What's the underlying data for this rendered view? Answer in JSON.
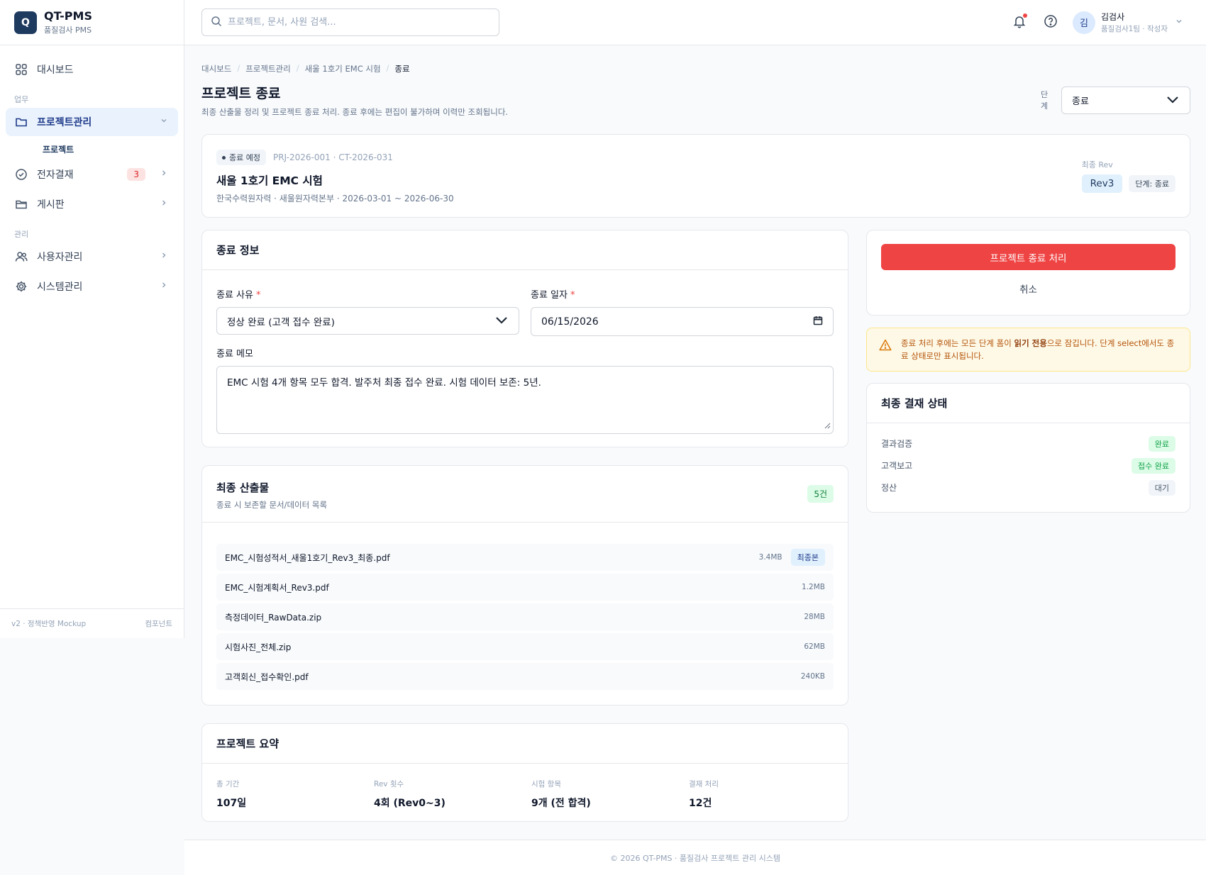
{
  "brand": {
    "logo": "Q",
    "title": "QT-PMS",
    "subtitle": "품질검사 PMS"
  },
  "sidebar": {
    "items": [
      {
        "label": "대시보드",
        "icon": "dashboard-icon"
      },
      {
        "section": "업무"
      },
      {
        "label": "프로젝트관리",
        "icon": "folder-icon",
        "active": true
      },
      {
        "sub": "프로젝트"
      },
      {
        "label": "전자결재",
        "icon": "check-circle-icon",
        "badge": "3"
      },
      {
        "label": "게시판",
        "icon": "folder-open-icon"
      },
      {
        "section": "관리"
      },
      {
        "label": "사용자관리",
        "icon": "users-icon"
      },
      {
        "label": "시스템관리",
        "icon": "gear-icon"
      }
    ],
    "footer_left": "v2 · 정책반영 Mockup",
    "footer_right": "컴포넌트"
  },
  "topbar": {
    "search_placeholder": "프로젝트, 문서, 사원 검색...",
    "user": {
      "initial": "김",
      "name": "김검사",
      "role": "품질검사1팀 · 작성자"
    }
  },
  "breadcrumb": [
    "대시보드",
    "프로젝트관리",
    "새울 1호기 EMC 시험",
    "종료"
  ],
  "page": {
    "title": "프로젝트 종료",
    "desc": "최종 산출물 정리 및 프로젝트 종료 처리. 종료 후에는 편집이 불가하며 이력만 조회됩니다.",
    "stage_label": "단계",
    "stage_value": "종료"
  },
  "project": {
    "status": "종료 예정",
    "codes": "PRJ-2026-001 · CT-2026-031",
    "name": "새울 1호기 EMC 시험",
    "meta": "한국수력원자력 · 새울원자력본부 · 2026-03-01 ~ 2026-06-30",
    "rev_label": "최종 Rev",
    "rev": "Rev3",
    "stage_tag": "단계: 종료"
  },
  "close_info": {
    "title": "종료 정보",
    "reason_label": "종료 사유",
    "reason_value": "정상 완료 (고객 접수 완료)",
    "date_label": "종료 일자",
    "date_value": "06/15/2026",
    "memo_label": "종료 메모",
    "memo_value": "EMC 시험 4개 항목 모두 합격. 발주처 최종 접수 완료. 시험 데이터 보존: 5년."
  },
  "deliverables": {
    "title": "최종 산출물",
    "subtitle": "종료 시 보존할 문서/데이터 목록",
    "count": "5건",
    "files": [
      {
        "name": "EMC_시험성적서_새울1호기_Rev3_최종.pdf",
        "size": "3.4MB",
        "badge": "최종본"
      },
      {
        "name": "EMC_시험계획서_Rev3.pdf",
        "size": "1.2MB"
      },
      {
        "name": "측정데이터_RawData.zip",
        "size": "28MB"
      },
      {
        "name": "시험사진_전체.zip",
        "size": "62MB"
      },
      {
        "name": "고객회신_접수확인.pdf",
        "size": "240KB"
      }
    ]
  },
  "summary": {
    "title": "프로젝트 요약",
    "items": [
      {
        "label": "총 기간",
        "value": "107일"
      },
      {
        "label": "Rev 횟수",
        "value": "4회 (Rev0~3)"
      },
      {
        "label": "시험 항목",
        "value": "9개 (전 합격)"
      },
      {
        "label": "결재 처리",
        "value": "12건"
      }
    ]
  },
  "actions": {
    "primary": "프로젝트 종료 처리",
    "cancel": "취소"
  },
  "warning": {
    "part1": "종료 처리 후에는 모든 단계 폼이 ",
    "bold": "읽기 전용",
    "part2": "으로 잠깁니다. 단계 select에서도 종료 상태로만 표시됩니다."
  },
  "approval": {
    "title": "최종 결재 상태",
    "rows": [
      {
        "label": "결과검증",
        "status": "완료",
        "color": "#16a34a",
        "bg": "#dcfce7"
      },
      {
        "label": "고객보고",
        "status": "접수 완료",
        "color": "#16a34a",
        "bg": "#dcfce7"
      },
      {
        "label": "정산",
        "status": "대기",
        "color": "#475569",
        "bg": "#f1f5f9"
      }
    ]
  },
  "footer": "© 2026 QT-PMS · 품질검사 프로젝트 관리 시스템",
  "colors": {
    "brand": "#1e3a5f",
    "danger": "#ef4444",
    "active_bg": "#eaf3fd"
  }
}
